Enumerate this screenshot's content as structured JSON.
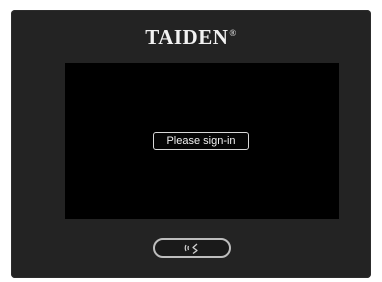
{
  "device": {
    "brand": "TAIDEN",
    "brand_mark": "®"
  },
  "screen": {
    "signin_label": "Please sign-in"
  },
  "controls": {
    "nfc_icon": "nfc-card-icon"
  },
  "colors": {
    "bezel": "#232323",
    "screen": "#000000",
    "text": "#f2f2f2",
    "button_border": "#bdbdbd"
  }
}
